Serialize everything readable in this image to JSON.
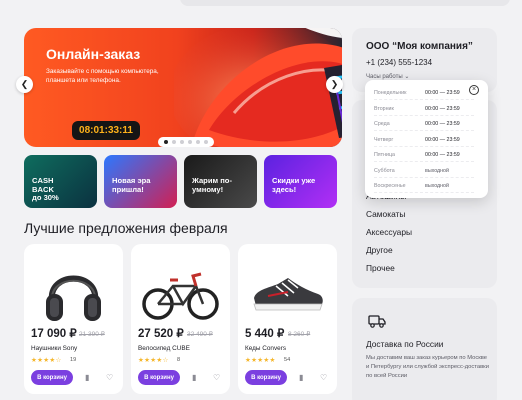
{
  "hero": {
    "title": "Онлайн-заказ",
    "subtitle": "Заказывайте с помощью компьютера, планшета или телефона.",
    "timer": "08:01:33:11",
    "prev_icon": "chevron-left-icon",
    "next_icon": "chevron-right-icon",
    "slides_total": 6,
    "active_slide": 1
  },
  "promos": [
    {
      "label": "CASH\nBACK\nдо 30%",
      "color_from": "#0f6d5e",
      "color_to": "#0b3140"
    },
    {
      "label": "Новая эра\nпришла!",
      "color_from": "#2c78ff",
      "color_to": "#d21f52"
    },
    {
      "label": "Жарим по-\nумному!",
      "color_from": "#1a1a1a",
      "color_to": "#4a4a4a"
    },
    {
      "label": "Скидки уже\nздесь!",
      "color_from": "#5b22e0",
      "color_to": "#b22ff5"
    }
  ],
  "section_title": "Лучшие предложения февраля",
  "products": [
    {
      "price": "17 090 ₽",
      "old_price": "21 390 ₽",
      "name": "Наушники Sony",
      "rating": 4,
      "reviews": "19",
      "buy_label": "В корзину"
    },
    {
      "price": "27 520 ₽",
      "old_price": "32 490 ₽",
      "name": "Велосипед CUBE",
      "rating": 4,
      "reviews": "8",
      "buy_label": "В корзину"
    },
    {
      "price": "5 440 ₽",
      "old_price": "8 260 ₽",
      "name": "Кеды Convers",
      "rating": 5,
      "reviews": "54",
      "buy_label": "В корзину"
    }
  ],
  "company": {
    "name": "ООО “Моя компания”",
    "phone": "+1 (234) 555-1234",
    "hours_label": "Часы работы"
  },
  "hours": [
    {
      "day": "Понедельник",
      "time": "00:00 — 23:59"
    },
    {
      "day": "Вторник",
      "time": "00:00 — 23:59"
    },
    {
      "day": "Среда",
      "time": "00:00 — 23:59"
    },
    {
      "day": "Четверг",
      "time": "00:00 — 23:59"
    },
    {
      "day": "Пятница",
      "time": "00:00 — 23:59"
    },
    {
      "day": "Суббота",
      "time": "выходной"
    },
    {
      "day": "Воскресенье",
      "time": "выходной"
    }
  ],
  "categories": [
    "Автошины",
    "Самокаты",
    "Аксессуары",
    "Другое",
    "Прочее"
  ],
  "delivery": {
    "title": "Доставка по России",
    "text": "Мы доставим ваш заказ курьером по Москве и Петербургу или службой экспресс-доставки по всей России",
    "icon": "truck-icon"
  },
  "colors": {
    "accent": "#7b3fe0",
    "timer_text": "#ffb21a",
    "stars": "#f5b62a"
  }
}
